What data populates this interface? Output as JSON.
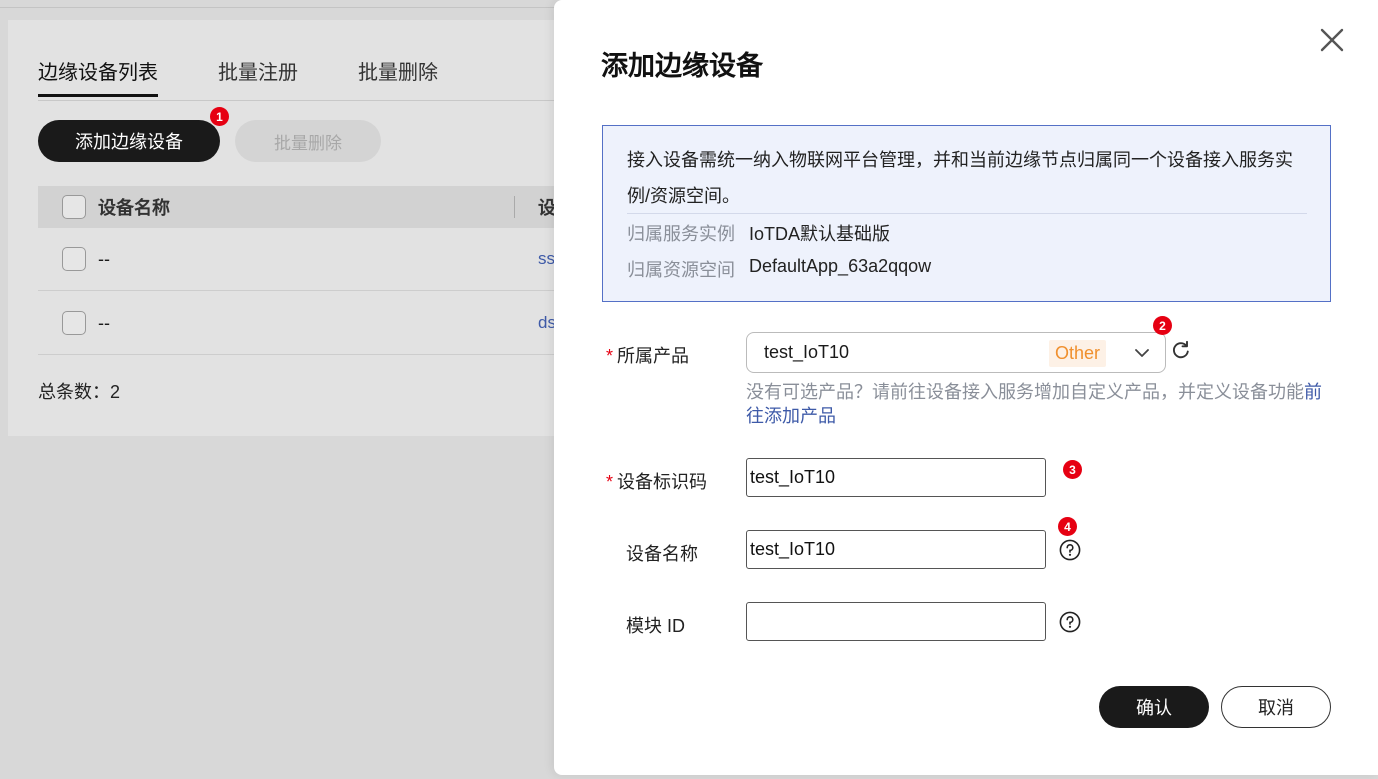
{
  "background": {
    "tabs": [
      "边缘设备列表",
      "批量注册",
      "批量删除"
    ],
    "add_button": "添加边缘设备",
    "delete_button": "批量删除",
    "table": {
      "columns": [
        "设备名称",
        "设"
      ],
      "rows": [
        {
          "name": "--",
          "link": "ss"
        },
        {
          "name": "--",
          "link": "ds"
        }
      ]
    },
    "total": "总条数：2"
  },
  "badges": [
    "1",
    "2",
    "3",
    "4"
  ],
  "dialog": {
    "title": "添加边缘设备",
    "info": {
      "text": "接入设备需统一纳入物联网平台管理，并和当前边缘节点归属同一个设备接入服务实例/资源空间。",
      "instance_label": "归属服务实例",
      "instance_value": "IoTDA默认基础版",
      "space_label": "归属资源空间",
      "space_value": "DefaultApp_63a2qqow"
    },
    "product": {
      "required_mark": "*",
      "label": "所属产品",
      "value": "test_IoT10",
      "tag": "Other",
      "hint": "没有可选产品？请前往设备接入服务增加自定义产品，并定义设备功能",
      "hint_link": "前往添加产品"
    },
    "device_id": {
      "required_mark": "*",
      "label": "设备标识码",
      "value": "test_IoT10"
    },
    "device_name": {
      "label": "设备名称",
      "value": "test_IoT10"
    },
    "module_id": {
      "label": "模块 ID",
      "value": ""
    },
    "confirm": "确认",
    "cancel": "取消"
  },
  "colors": {
    "accent": "#1a1a1a",
    "badge": "#e60012",
    "link": "#3e5aa8",
    "tag": "#f0902e"
  }
}
